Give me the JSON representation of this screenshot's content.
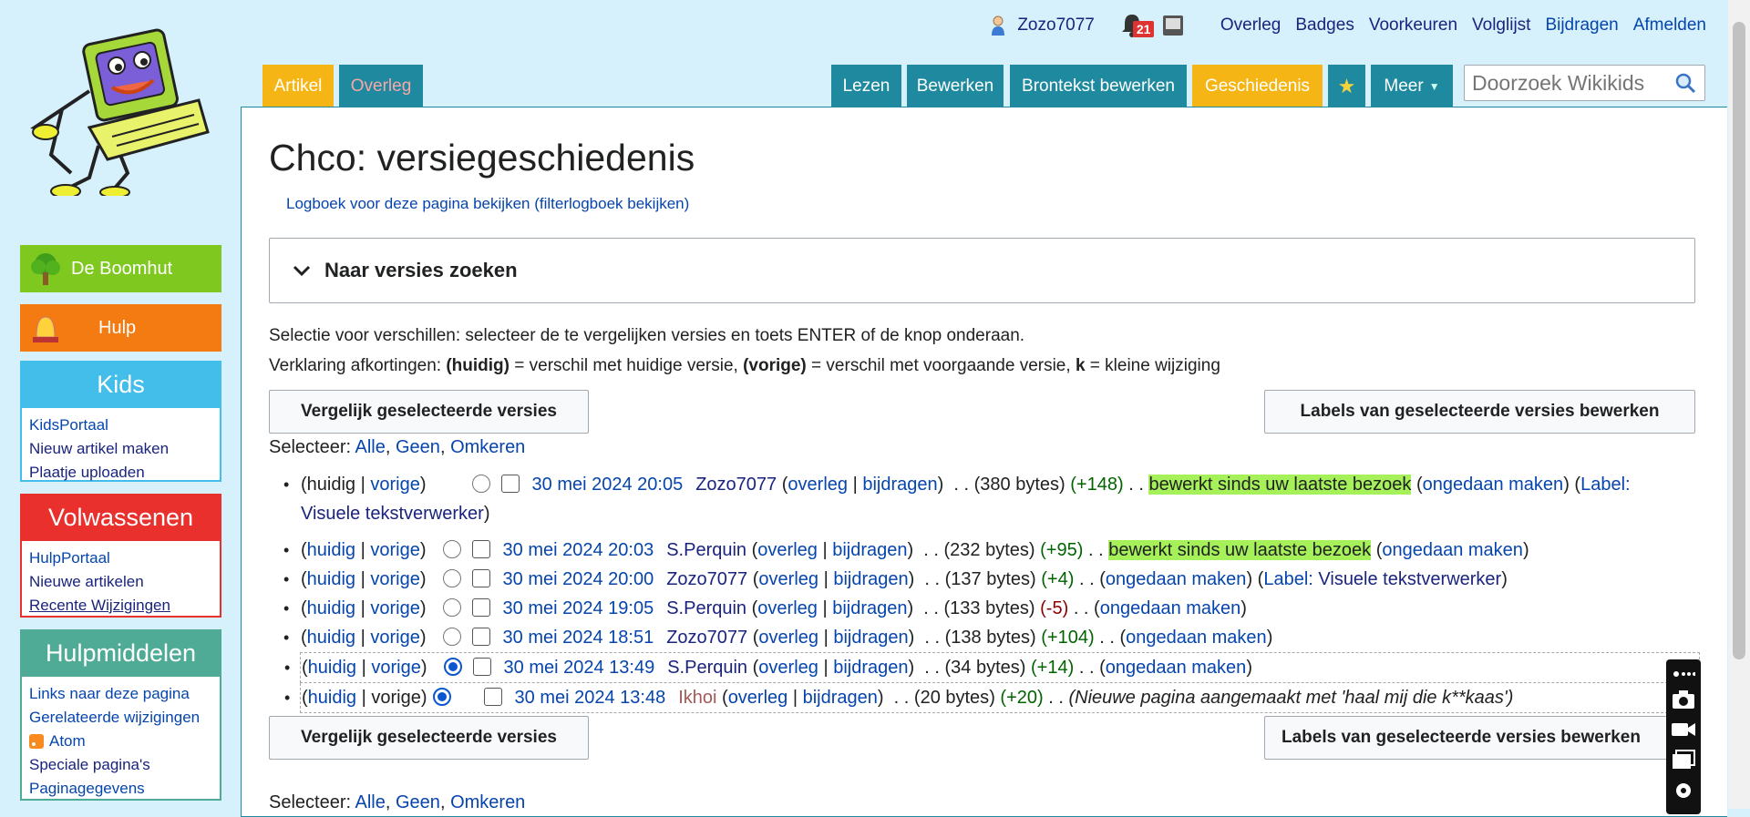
{
  "personal": {
    "username": "Zozo7077",
    "notification_count": "21",
    "links": [
      "Overleg",
      "Badges",
      "Voorkeuren",
      "Volglijst",
      "Bijdragen",
      "Afmelden"
    ]
  },
  "tabs": {
    "artikel": "Artikel",
    "overleg": "Overleg",
    "lezen": "Lezen",
    "bewerken": "Bewerken",
    "brontekst": "Brontekst bewerken",
    "geschiedenis": "Geschiedenis",
    "meer": "Meer"
  },
  "search": {
    "placeholder": "Doorzoek Wikikids"
  },
  "sidebar": {
    "boomhut": "De Boomhut",
    "hulp": "Hulp",
    "kids": {
      "title": "Kids",
      "items": [
        "KidsPortaal",
        "Nieuw artikel maken",
        "Plaatje uploaden"
      ]
    },
    "volwassenen": {
      "title": "Volwassenen",
      "items": [
        "HulpPortaal",
        "Nieuwe artikelen",
        "Recente Wijzigingen"
      ]
    },
    "hulpmiddelen": {
      "title": "Hulpmiddelen",
      "items": [
        "Links naar deze pagina",
        "Gerelateerde wijzigingen",
        "Atom",
        "Speciale pagina's",
        "Paginagegevens"
      ]
    }
  },
  "page": {
    "title": "Chco: versiegeschiedenis",
    "logline_a": "Logboek voor deze pagina bekijken",
    "logline_b": "(filterlogboek bekijken)",
    "search_panel": "Naar versies zoeken",
    "info1": "Selectie voor verschillen: selecteer de te vergelijken versies en toets ENTER of de knop onderaan.",
    "info2_prefix": "Verklaring afkortingen: ",
    "info2_huidig": "(huidig)",
    "info2_huidig_desc": " = verschil met huidige versie, ",
    "info2_vorige": "(vorige)",
    "info2_vorige_desc": " = verschil met voorgaande versie, ",
    "info2_k": "k",
    "info2_k_desc": " = kleine wijziging",
    "compare_btn": "Vergelijk geselecteerde versies",
    "labels_btn": "Labels van geselecteerde versies bewerken",
    "select_label": "Selecteer:",
    "select_all": "Alle",
    "select_none": "Geen",
    "select_invert": "Omkeren"
  },
  "history_words": {
    "huidig": "huidig",
    "vorige": "vorige",
    "overleg": "overleg",
    "bijdragen": "bijdragen",
    "ongedaan": "ongedaan maken",
    "seen": "bewerkt sinds uw laatste bezoek",
    "label_prefix": "Label:",
    "visual_editor": "Visuele tekstverwerker"
  },
  "revisions": [
    {
      "date": "30 mei 2024 20:05",
      "user": "Zozo7077",
      "bytes": "380 bytes",
      "diff": "+148"
    },
    {
      "date": "30 mei 2024 20:03",
      "user": "S.Perquin",
      "bytes": "232 bytes",
      "diff": "+95"
    },
    {
      "date": "30 mei 2024 20:00",
      "user": "Zozo7077",
      "bytes": "137 bytes",
      "diff": "+4"
    },
    {
      "date": "30 mei 2024 19:05",
      "user": "S.Perquin",
      "bytes": "133 bytes",
      "diff": "-5"
    },
    {
      "date": "30 mei 2024 18:51",
      "user": "Zozo7077",
      "bytes": "138 bytes",
      "diff": "+104"
    },
    {
      "date": "30 mei 2024 13:49",
      "user": "S.Perquin",
      "bytes": "34 bytes",
      "diff": "+14"
    },
    {
      "date": "30 mei 2024 13:48",
      "user": "Ikhoi",
      "bytes": "20 bytes",
      "diff": "+20",
      "comment": "(Nieuwe pagina aangemaakt met 'haal mij die k**kaas')"
    }
  ],
  "colors": {
    "tab_teal": "#1f8a9f",
    "tab_yellow": "#f5b615",
    "highlight": "#a6f05a",
    "background": "#d6f1fb"
  }
}
